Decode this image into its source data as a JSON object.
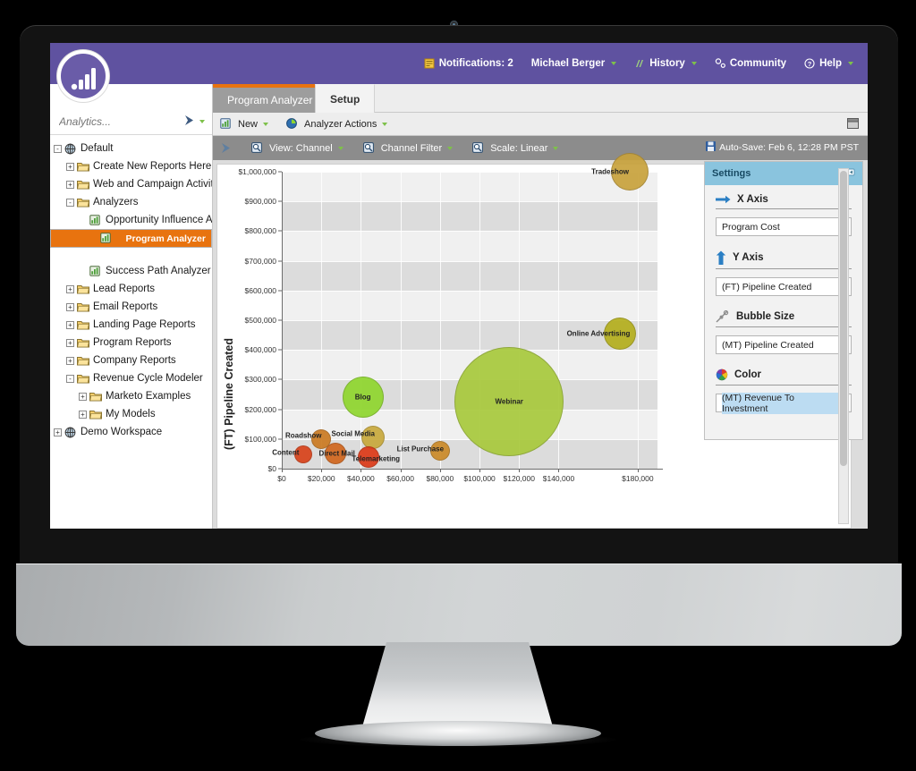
{
  "topnav": {
    "items": [
      {
        "label": "Notifications: 2",
        "icon": "notifications-icon",
        "caret": false
      },
      {
        "label": "Michael Berger",
        "icon": "",
        "caret": true
      },
      {
        "label": "History",
        "icon": "history-icon",
        "caret": true
      },
      {
        "label": "Community",
        "icon": "community-icon",
        "caret": false
      },
      {
        "label": "Help",
        "icon": "help-icon",
        "caret": true
      }
    ]
  },
  "tabs": [
    {
      "label": "Program Analyzer",
      "active": false
    },
    {
      "label": "Setup",
      "active": true
    }
  ],
  "sidebar": {
    "search_placeholder": "Analytics...",
    "tree": [
      {
        "label": "Default",
        "indent": 0,
        "expander": "-",
        "icon": "globe-icon",
        "selected": false
      },
      {
        "label": "Create New Reports Here",
        "indent": 1,
        "expander": "+",
        "icon": "folder-icon",
        "selected": false
      },
      {
        "label": "Web and Campaign Activity",
        "indent": 1,
        "expander": "+",
        "icon": "folder-icon",
        "selected": false
      },
      {
        "label": "Analyzers",
        "indent": 1,
        "expander": "-",
        "icon": "folder-icon",
        "selected": false
      },
      {
        "label": "Opportunity Influence Analyzer",
        "indent": 2,
        "expander": "",
        "icon": "report-icon",
        "selected": false
      },
      {
        "label": "Program Analyzer",
        "indent": 2,
        "expander": "",
        "icon": "report-icon",
        "selected": true
      },
      {
        "label": "Success Path Analyzer",
        "indent": 2,
        "expander": "",
        "icon": "report-icon",
        "selected": false
      },
      {
        "label": "Lead Reports",
        "indent": 1,
        "expander": "+",
        "icon": "folder-icon",
        "selected": false
      },
      {
        "label": "Email Reports",
        "indent": 1,
        "expander": "+",
        "icon": "folder-icon",
        "selected": false
      },
      {
        "label": "Landing Page Reports",
        "indent": 1,
        "expander": "+",
        "icon": "folder-icon",
        "selected": false
      },
      {
        "label": "Program Reports",
        "indent": 1,
        "expander": "+",
        "icon": "folder-icon",
        "selected": false
      },
      {
        "label": "Company Reports",
        "indent": 1,
        "expander": "+",
        "icon": "folder-icon",
        "selected": false
      },
      {
        "label": "Revenue Cycle Modeler",
        "indent": 1,
        "expander": "-",
        "icon": "folder-icon",
        "selected": false
      },
      {
        "label": "Marketo Examples",
        "indent": 2,
        "expander": "+",
        "icon": "folder-icon",
        "selected": false
      },
      {
        "label": "My Models",
        "indent": 2,
        "expander": "+",
        "icon": "folder-icon",
        "selected": false
      },
      {
        "label": "Demo Workspace",
        "indent": 0,
        "expander": "+",
        "icon": "globe-icon",
        "selected": false
      }
    ]
  },
  "toolbar_primary": [
    {
      "label": "New",
      "icon": "new-report-icon",
      "caret": true
    },
    {
      "label": "Analyzer Actions",
      "icon": "analyzer-actions-icon",
      "caret": true
    }
  ],
  "toolbar_secondary": [
    {
      "label": "View: Channel",
      "icon": "magnifier-icon",
      "caret": true
    },
    {
      "label": "Channel Filter",
      "icon": "magnifier-icon",
      "caret": true
    },
    {
      "label": "Scale: Linear",
      "icon": "magnifier-icon",
      "caret": true
    }
  ],
  "autosave": {
    "label": "Auto-Save: Feb 6, 12:28 PM PST",
    "icon": "save-icon"
  },
  "settings": {
    "title": "Settings",
    "collapse_icon": "collapse-icon",
    "groups": [
      {
        "name": "X Axis",
        "icon": "x-axis-arrow-icon",
        "value": "Program Cost",
        "highlighted": false
      },
      {
        "name": "Y Axis",
        "icon": "y-axis-arrow-icon",
        "value": "(FT) Pipeline Created",
        "highlighted": false
      },
      {
        "name": "Bubble Size",
        "icon": "bubble-size-icon",
        "value": "(MT) Pipeline Created",
        "highlighted": false
      },
      {
        "name": "Color",
        "icon": "color-wheel-icon",
        "value": "(MT) Revenue To Investment",
        "highlighted": true
      }
    ]
  },
  "chart_data": {
    "type": "scatter",
    "title": "",
    "xlabel": "",
    "ylabel": "(FT) Pipeline Created",
    "xlim": [
      0,
      190000
    ],
    "ylim": [
      0,
      1000000
    ],
    "grid": true,
    "legend": "none",
    "xticks": [
      "$0",
      "$20,000",
      "$40,000",
      "$60,000",
      "$80,000",
      "$100,000",
      "$120,000",
      "$140,000",
      "$180,000"
    ],
    "xtick_values": [
      0,
      20000,
      40000,
      60000,
      80000,
      100000,
      120000,
      140000,
      180000
    ],
    "yticks": [
      "$0",
      "$100,000",
      "$200,000",
      "$300,000",
      "$400,000",
      "$500,000",
      "$600,000",
      "$700,000",
      "$800,000",
      "$900,000",
      "$1,000,000"
    ],
    "ytick_values": [
      0,
      100000,
      200000,
      300000,
      400000,
      500000,
      600000,
      700000,
      800000,
      900000,
      1000000
    ],
    "points": [
      {
        "label": "Tradeshow",
        "x": 176000,
        "y": 1000000,
        "r": 21,
        "color": "#c8a23c",
        "label_dx": -22,
        "label_dy": 0
      },
      {
        "label": "Online Advertising",
        "x": 171000,
        "y": 455000,
        "r": 18,
        "color": "#b4af1e",
        "label_dx": -24,
        "label_dy": 0
      },
      {
        "label": "Webinar",
        "x": 115000,
        "y": 225000,
        "r": 61,
        "color": "#a8c93c",
        "label_dx": 0,
        "label_dy": 0
      },
      {
        "label": "Blog",
        "x": 41000,
        "y": 240000,
        "r": 23,
        "color": "#8fd62e",
        "label_dx": 0,
        "label_dy": 0
      },
      {
        "label": "Social Media",
        "x": 46000,
        "y": 105000,
        "r": 13,
        "color": "#c8a93c",
        "label_dx": -22,
        "label_dy": -4
      },
      {
        "label": "Roadshow",
        "x": 20000,
        "y": 100000,
        "r": 11,
        "color": "#cb7a22",
        "label_dx": -20,
        "label_dy": -4
      },
      {
        "label": "List Purchase",
        "x": 80000,
        "y": 60000,
        "r": 11,
        "color": "#cb8a28",
        "label_dx": -22,
        "label_dy": -2
      },
      {
        "label": "Content",
        "x": 11000,
        "y": 48000,
        "r": 10,
        "color": "#d8431a",
        "label_dx": -20,
        "label_dy": -2
      },
      {
        "label": "Direct Mail",
        "x": 27000,
        "y": 50000,
        "r": 12,
        "color": "#d1661e",
        "label_dx": 2,
        "label_dy": 0
      },
      {
        "label": "Telemarketing",
        "x": 44000,
        "y": 38000,
        "r": 12,
        "color": "#dd3a18",
        "label_dx": 8,
        "label_dy": 2
      }
    ]
  },
  "colors": {
    "brand_purple": "#5f52a0",
    "selection_orange": "#e8730f",
    "settings_header_blue": "#8ac4de",
    "toolbar_gray": "#8c8c8c"
  }
}
